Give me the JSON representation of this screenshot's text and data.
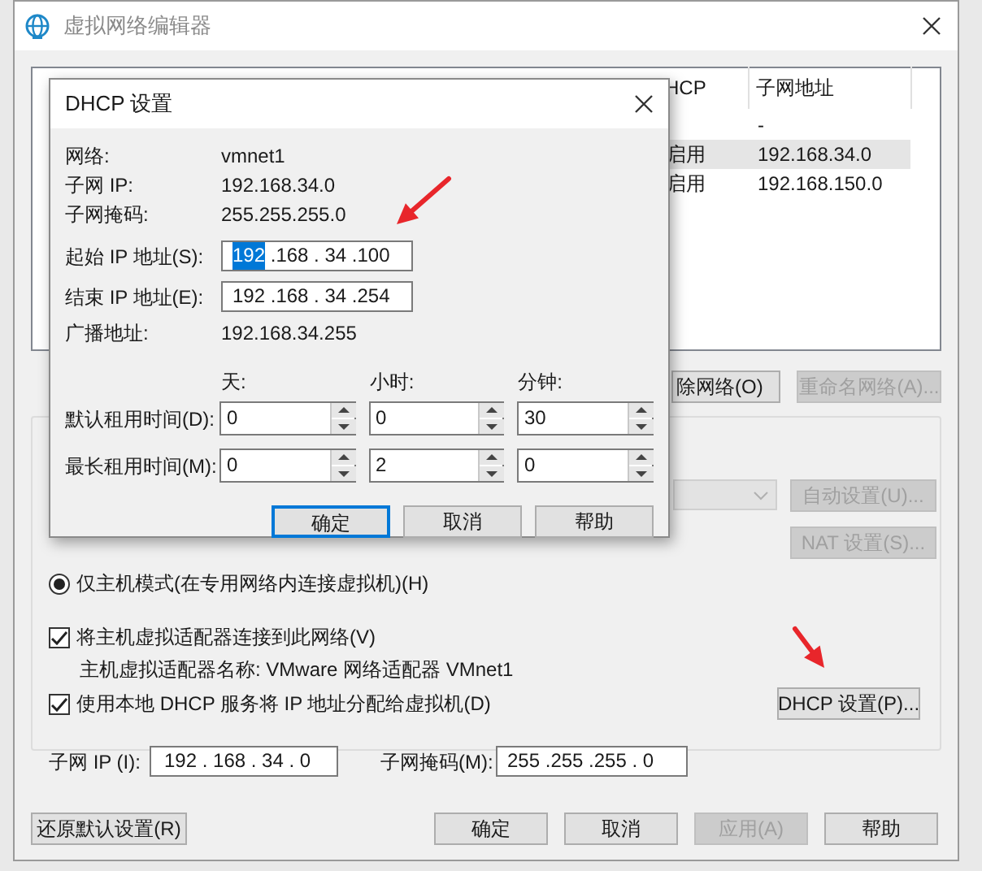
{
  "window": {
    "title": "虚拟网络编辑器"
  },
  "network_table": {
    "columns": [
      "HCP",
      "子网地址"
    ],
    "rows": [
      {
        "subnet": "-",
        "selected": false
      },
      {
        "dhcp": "启用",
        "subnet": "192.168.34.0",
        "selected": true
      },
      {
        "dhcp": "启用",
        "subnet": "192.168.150.0",
        "selected": false
      }
    ]
  },
  "network_buttons": [
    {
      "label": "除网络(O)",
      "disabled": false
    },
    {
      "label": "重命名网络(A)...",
      "disabled": true
    }
  ],
  "settings": {
    "bridge_dropdown": {
      "disabled": true
    },
    "auto_button": {
      "label": "自动设置(U)...",
      "disabled": true
    },
    "nat_button": {
      "label": "NAT 设置(S)...",
      "disabled": true
    },
    "host_only": {
      "label": "仅主机模式(在专用网络内连接虚拟机)(H)",
      "selected": true
    },
    "connect_adapter": {
      "label": "将主机虚拟适配器连接到此网络(V)",
      "checked": true
    },
    "adapter_name": "主机虚拟适配器名称: VMware 网络适配器 VMnet1",
    "use_dhcp": {
      "label": "使用本地 DHCP 服务将 IP 地址分配给虚拟机(D)",
      "checked": true
    },
    "dhcp_button": {
      "label": "DHCP 设置(P)...",
      "disabled": false
    },
    "subnet_ip": {
      "label": "子网 IP (I):",
      "value": "192 . 168 . 34 . 0"
    },
    "subnet_mask": {
      "label": "子网掩码(M):",
      "value": "255 .255 .255 . 0"
    }
  },
  "restore_button": {
    "label": "还原默认设置(R)",
    "disabled": false
  },
  "footer_buttons": [
    {
      "label": "确定",
      "disabled": false
    },
    {
      "label": "取消",
      "disabled": false
    },
    {
      "label": "应用(A)",
      "disabled": true
    },
    {
      "label": "帮助",
      "disabled": false
    }
  ],
  "dhcp_dialog": {
    "title": "DHCP 设置",
    "info": [
      {
        "label": "网络:",
        "value": "vmnet1"
      },
      {
        "label": "子网 IP:",
        "value": "192.168.34.0"
      },
      {
        "label": "子网掩码:",
        "value": "255.255.255.0"
      }
    ],
    "start_ip": {
      "label": "起始 IP 地址(S):",
      "parts": [
        {
          "text": "192",
          "selected": true
        },
        {
          "text": " .168 . 34 .100",
          "selected": false
        }
      ]
    },
    "end_ip": {
      "label": "结束 IP 地址(E):",
      "parts": [
        {
          "text": "192 .168 . 34 .254",
          "selected": false
        }
      ]
    },
    "broadcast": {
      "label": "广播地址:",
      "value": "192.168.34.255"
    },
    "lease_units": [
      "天:",
      "小时:",
      "分钟:"
    ],
    "lease_rows": [
      {
        "label": "默认租用时间(D):",
        "values": [
          "0",
          "0",
          "30"
        ]
      },
      {
        "label": "最长租用时间(M):",
        "values": [
          "0",
          "2",
          "0"
        ]
      }
    ],
    "buttons": [
      {
        "label": "确定",
        "default": true
      },
      {
        "label": "取消",
        "default": false
      },
      {
        "label": "帮助",
        "default": false
      }
    ]
  }
}
